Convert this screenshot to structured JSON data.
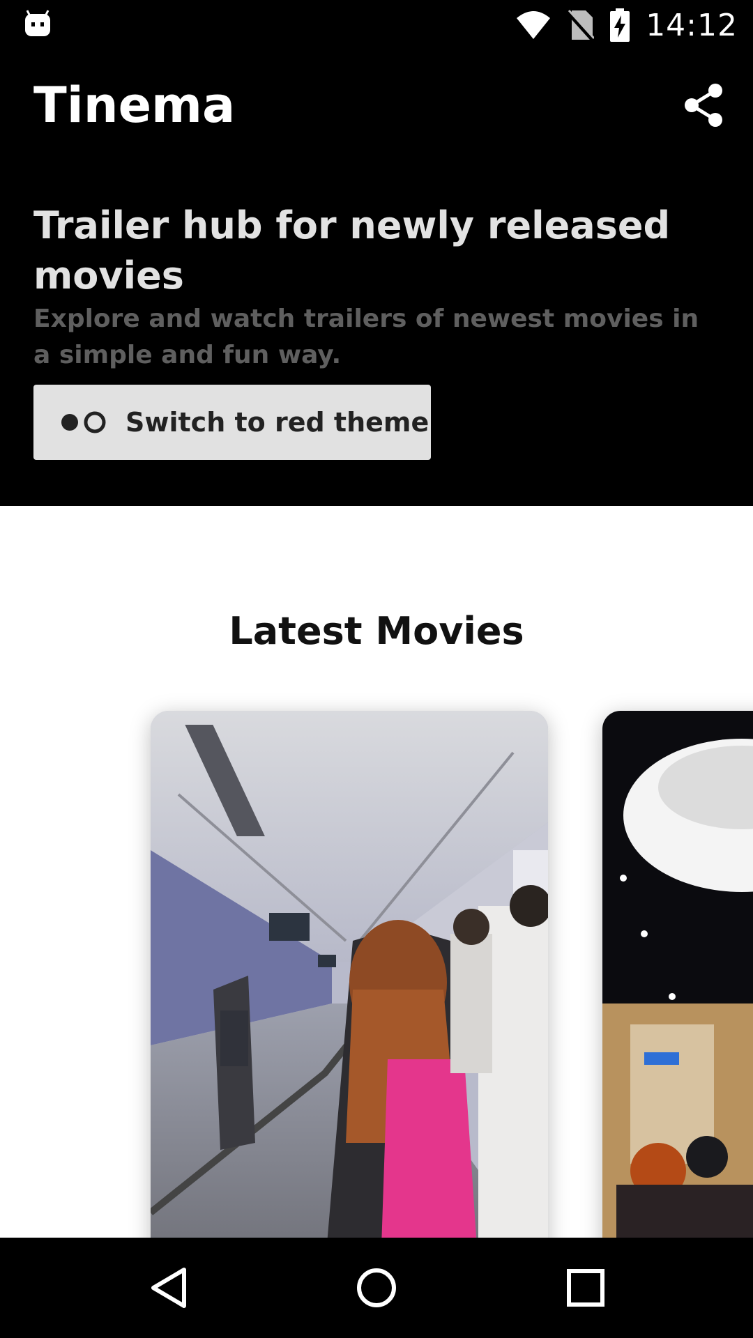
{
  "status_bar": {
    "time": "14:12",
    "icons": [
      "android-debug-icon",
      "wifi-icon",
      "no-sim-icon",
      "battery-charging-icon"
    ]
  },
  "app_bar": {
    "title": "Tinema",
    "share_icon": "share-icon"
  },
  "hero": {
    "title": "Trailer hub for newly released movies",
    "subtitle": "Explore and watch trailers of newest movies in a simple and fun way.",
    "theme_button": {
      "icon": "theme-toggle-icon",
      "label": "Switch to red theme"
    }
  },
  "section": {
    "title": "Latest Movies"
  },
  "movies": [
    {
      "image": "airport-walkway-photo"
    },
    {
      "image": "mall-interior-photo"
    }
  ],
  "nav_bar": {
    "icons": [
      "back-icon",
      "home-icon",
      "recents-icon"
    ]
  },
  "colors": {
    "header_bg": "#000000",
    "content_bg": "#ffffff",
    "button_bg": "#e1e1e1",
    "subtitle": "#5f5f5f"
  }
}
